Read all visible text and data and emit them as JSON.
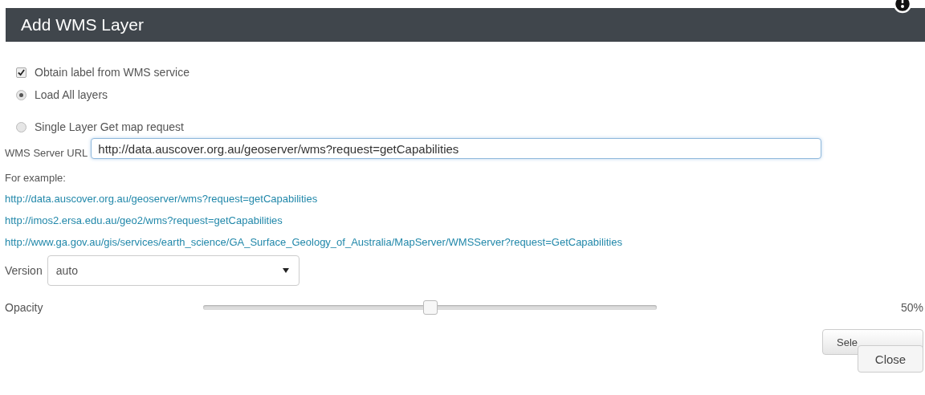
{
  "dialog": {
    "title": "Add WMS Layer"
  },
  "options": [
    {
      "kind": "checkbox",
      "label": "Obtain label from WMS service",
      "checked": true
    },
    {
      "kind": "radio",
      "label": "Load All layers",
      "selected": true
    },
    {
      "kind": "radio",
      "label": "Single Layer Get map request",
      "selected": false
    }
  ],
  "server_url": {
    "label": "WMS Server URL",
    "value": "http://data.auscover.org.au/geoserver/wms?request=getCapabilities"
  },
  "examples": {
    "heading": "For example:",
    "links": [
      "http://data.auscover.org.au/geoserver/wms?request=getCapabilities",
      "http://imos2.ersa.edu.au/geo2/wms?request=getCapabilities",
      "http://www.ga.gov.au/gis/services/earth_science/GA_Surface_Geology_of_Australia/MapServer/WMSServer?request=GetCapabilities"
    ]
  },
  "version": {
    "label": "Version",
    "value": "auto"
  },
  "opacity": {
    "label": "Opacity",
    "level": 0.5,
    "reading": "50%"
  },
  "buttons": [
    "Sele",
    "Close"
  ]
}
